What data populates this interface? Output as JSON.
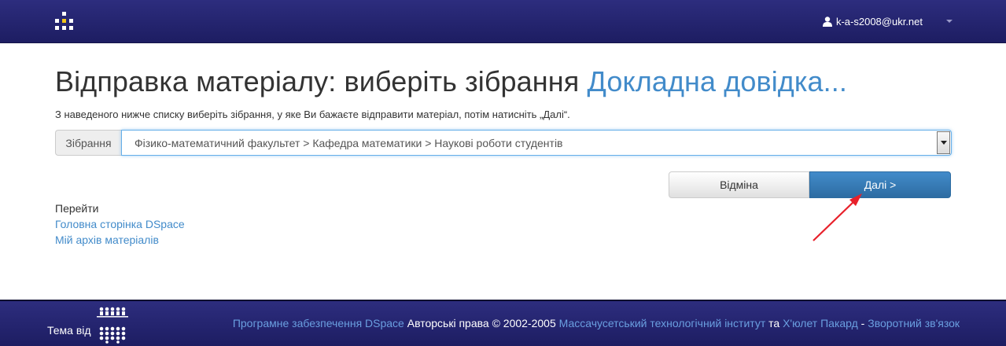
{
  "navbar": {
    "user_email": "k-a-s2008@ukr.net"
  },
  "page": {
    "title": "Відправка матеріалу: виберіть зібрання",
    "help_link": "Докладна довідка...",
    "intro": "З наведеного нижче списку виберіть зібрання, у яке Ви бажаєте відправити матеріал, потім натисніть „Далі“."
  },
  "form": {
    "collection_label": "Зібрання",
    "collection_selected": "Фізико-математичний факультет > Кафедра математики > Наукові роботи студентів",
    "cancel_label": "Відміна",
    "next_label": "Далі >"
  },
  "goto": {
    "label": "Перейти",
    "links": [
      "Головна сторінка DSpace",
      "Мій архів матеріалів"
    ]
  },
  "footer": {
    "theme_by": "Тема від",
    "credits": {
      "software": "Програмне забезпечення DSpace",
      "copyright": " Авторські права © 2002-2005 ",
      "mit": "Массачусетський технологічний інститут",
      "and": " та ",
      "hp": "Х'юлет Пакард",
      "sep": " - ",
      "feedback": "Зворотний зв'язок"
    }
  },
  "colors": {
    "nav_bg": "#23236e",
    "link": "#428bca",
    "primary_button": "#3071a9",
    "annotation_arrow": "#e8202a"
  }
}
